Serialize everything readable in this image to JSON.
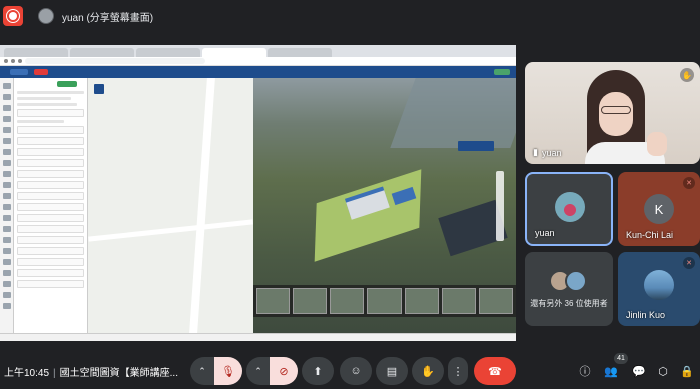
{
  "top": {
    "presenter_label": "yuan (分享螢幕畫面)"
  },
  "participants": {
    "main": {
      "name": "yuan"
    },
    "tile_yuan": {
      "name": "yuan"
    },
    "tile_kun": {
      "name": "Kun-Chi Lai",
      "initial": "K"
    },
    "others": {
      "caption": "還有另外 36 位使用者"
    },
    "tile_jinlin": {
      "name": "Jinlin Kuo"
    }
  },
  "bottom": {
    "time": "上午10:45",
    "meeting_title": "國土空間圖資【業師講座...",
    "people_count": "41"
  },
  "icons": {
    "record": "record-icon",
    "mic_off": "mic-off-icon",
    "cam_off": "camera-off-icon",
    "present": "present-icon",
    "emoji": "emoji-icon",
    "captions": "captions-icon",
    "raise_hand": "raise-hand-icon",
    "more": "more-icon",
    "end_call": "end-call-icon",
    "info": "info-icon",
    "people": "people-icon",
    "chat": "chat-icon",
    "activities": "activities-icon",
    "lock": "host-controls-icon"
  },
  "colors": {
    "background": "#202124",
    "end_call": "#ea4335",
    "muted_bg": "#f9dedc",
    "active_border": "#8ab4f8"
  }
}
